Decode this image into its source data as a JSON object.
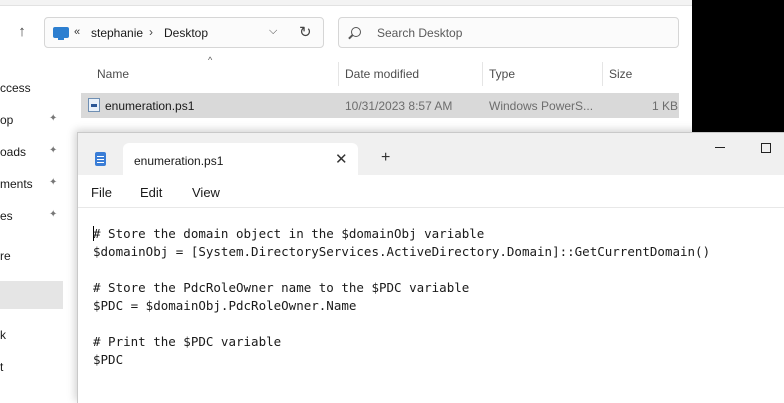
{
  "explorer": {
    "breadcrumb": {
      "overflow": "«",
      "items": [
        "stephanie",
        "Desktop"
      ],
      "separator": "›"
    },
    "search": {
      "placeholder": "Search Desktop"
    },
    "nav_items": [
      "ccess",
      "op",
      "oads",
      "ments",
      "es",
      "re",
      "",
      "k",
      "t"
    ],
    "columns": {
      "name": "Name",
      "date": "Date modified",
      "type": "Type",
      "size": "Size"
    },
    "files": [
      {
        "name": "enumeration.ps1",
        "date": "10/31/2023 8:57 AM",
        "type": "Windows PowerS...",
        "size": "1 KB"
      }
    ]
  },
  "notepad": {
    "tab_title": "enumeration.ps1",
    "menu": [
      "File",
      "Edit",
      "View"
    ],
    "lines": [
      "# Store the domain object in the $domainObj variable",
      "$domainObj = [System.DirectoryServices.ActiveDirectory.Domain]::GetCurrentDomain()",
      "",
      "# Store the PdcRoleOwner name to the $PDC variable",
      "$PDC = $domainObj.PdcRoleOwner.Name",
      "",
      "# Print the $PDC variable",
      "$PDC"
    ]
  },
  "colors": {
    "selected_row": "#d9d9d9",
    "titlebar": "#f0f0f0",
    "accent": "#2d7fd0"
  }
}
